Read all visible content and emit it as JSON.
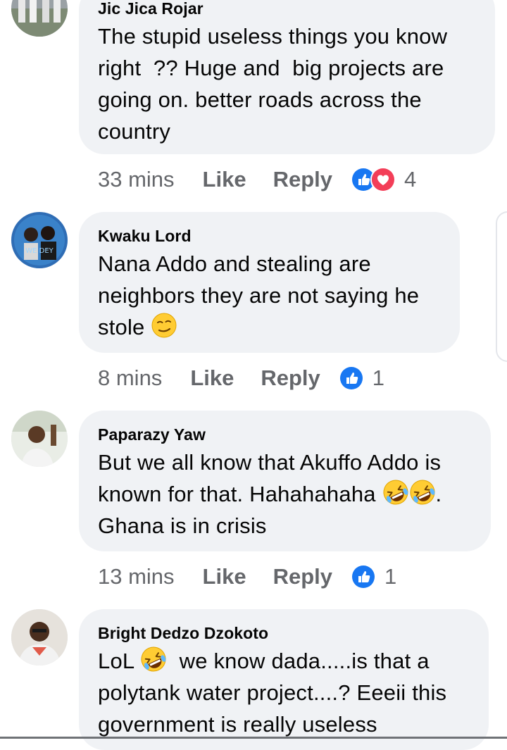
{
  "comments": [
    {
      "author": "Jic Jica Rojar",
      "lines": [
        "The stupid useless things you know",
        "right  ?? Huge and  big projects are",
        "going on. better roads across the",
        "country"
      ],
      "time": "33 mins",
      "like": "Like",
      "reply": "Reply",
      "reactions": [
        "like",
        "love"
      ],
      "count": "4"
    },
    {
      "author": "Kwaku Lord",
      "lines": [
        "Nana Addo and stealing are",
        "neighbors they are not saying he",
        "stole"
      ],
      "emoji_after_last_line": "smirking-face",
      "time": "8 mins",
      "like": "Like",
      "reply": "Reply",
      "reactions": [
        "like"
      ],
      "count": "1"
    },
    {
      "author": "Paparazy Yaw",
      "line1": "But we all know that Akuffo Addo is",
      "line2_text": "known for that. Hahahahaha ",
      "line2_end": ".",
      "line3": "Ghana is in crisis",
      "emojis": [
        "rolling-laughing-face",
        "rolling-laughing-face"
      ],
      "time": "13 mins",
      "like": "Like",
      "reply": "Reply",
      "reactions": [
        "like"
      ],
      "count": "1"
    },
    {
      "author": "Bright Dedzo Dzokoto",
      "line1_start": "LoL ",
      "line1_end": "  we know dada.....is that a",
      "line2": "polytank water project....? Eeeii this",
      "line3": "government is really useless",
      "emojis": [
        "rolling-laughing-face"
      ]
    }
  ],
  "colors": {
    "bubble": "#f0f2f5",
    "meta_text": "#65676b",
    "like_blue": "#1877f2",
    "love_red": "#f33e58"
  }
}
